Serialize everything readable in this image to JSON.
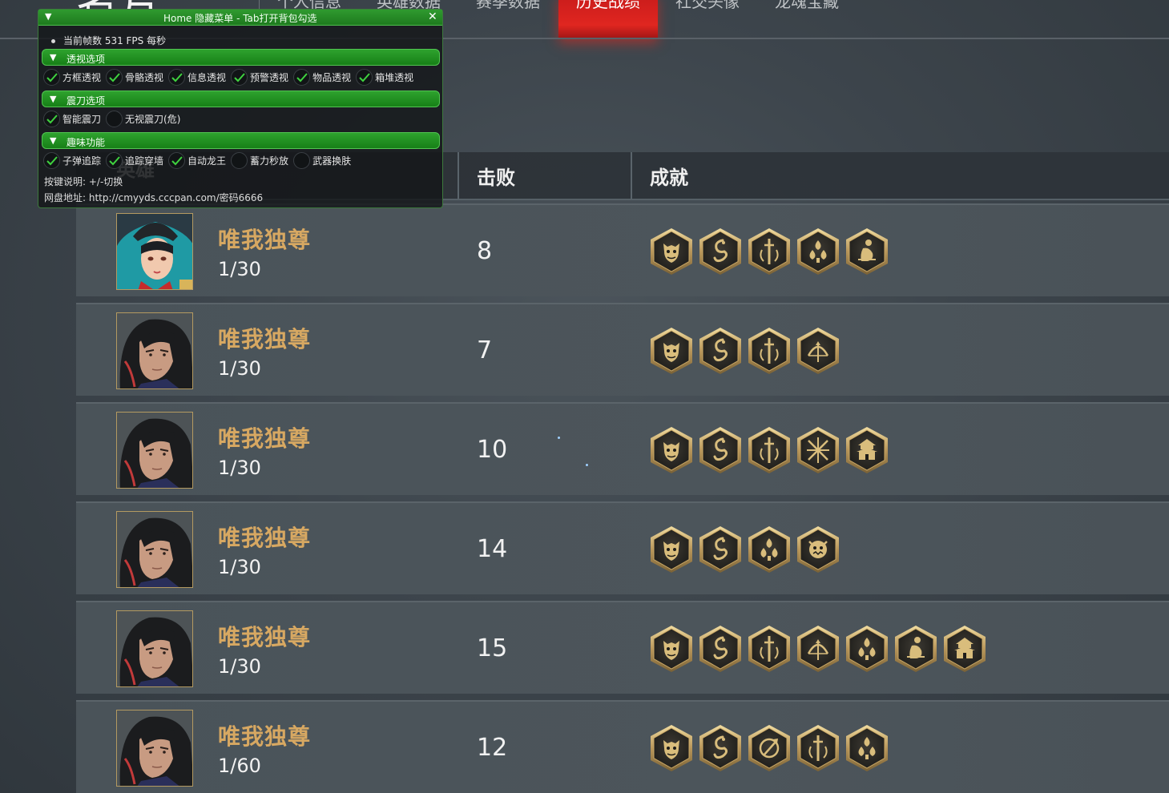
{
  "page_heading": "名片",
  "nav": {
    "tabs": [
      {
        "label": "个人信息",
        "active": false
      },
      {
        "label": "英雄数据",
        "active": false
      },
      {
        "label": "赛季数据",
        "active": false
      },
      {
        "label": "历史战绩",
        "active": true
      },
      {
        "label": "社交头像",
        "active": false
      },
      {
        "label": "龙魂宝藏",
        "active": false
      }
    ],
    "active_color": "#e02620"
  },
  "table": {
    "headers": {
      "hero": "英雄",
      "kills": "击败",
      "achievements": "成就"
    },
    "rows": [
      {
        "hero_name": "唯我独尊",
        "rank": "1/30",
        "kills": "8",
        "avatar": "female-hero-portrait",
        "badges": [
          "demon-mask-icon",
          "dragon-icon",
          "crossed-swords-icon",
          "spade-flowers-icon",
          "crouching-figure-icon"
        ]
      },
      {
        "hero_name": "唯我独尊",
        "rank": "1/30",
        "kills": "7",
        "avatar": "male-hero-portrait",
        "badges": [
          "demon-mask-icon",
          "dragon-icon",
          "crossed-swords-icon",
          "bow-icon"
        ]
      },
      {
        "hero_name": "唯我独尊",
        "rank": "1/30",
        "kills": "10",
        "avatar": "male-hero-portrait",
        "badges": [
          "demon-mask-icon",
          "dragon-icon",
          "crossed-swords-icon",
          "crossed-spears-icon",
          "pagoda-icon"
        ]
      },
      {
        "hero_name": "唯我独尊",
        "rank": "1/30",
        "kills": "14",
        "avatar": "male-hero-portrait",
        "badges": [
          "demon-mask-icon",
          "dragon-icon",
          "spade-flowers-icon",
          "beast-head-icon"
        ]
      },
      {
        "hero_name": "唯我独尊",
        "rank": "1/30",
        "kills": "15",
        "avatar": "male-hero-portrait",
        "badges": [
          "demon-mask-icon",
          "dragon-icon",
          "crossed-swords-icon",
          "bow-icon",
          "spade-flowers-icon",
          "crouching-figure-icon",
          "pagoda-icon"
        ]
      },
      {
        "hero_name": "唯我独尊",
        "rank": "1/60",
        "kills": "12",
        "avatar": "male-hero-portrait",
        "badges": [
          "demon-mask-icon",
          "dragon-icon",
          "spiral-arrow-icon",
          "crossed-swords-icon",
          "spade-flowers-icon"
        ]
      }
    ],
    "name_color": "#d7a862",
    "badge_gold": "#c9ad6f"
  },
  "overlay": {
    "title": "Home 隐藏菜单 - Tab打开背包勾选",
    "close": "✕",
    "fps": "当前帧数 531 FPS 每秒",
    "sections": [
      {
        "label": "透视选项",
        "options": [
          {
            "label": "方框透视",
            "checked": true
          },
          {
            "label": "骨骼透视",
            "checked": true
          },
          {
            "label": "信息透视",
            "checked": true
          },
          {
            "label": "预警透视",
            "checked": true
          },
          {
            "label": "物品透视",
            "checked": true
          },
          {
            "label": "箱堆透视",
            "checked": true
          }
        ]
      },
      {
        "label": "震刀选项",
        "options": [
          {
            "label": "智能震刀",
            "checked": true
          },
          {
            "label": "无视震刀(危)",
            "checked": false
          }
        ]
      },
      {
        "label": "趣味功能",
        "options": [
          {
            "label": "子弹追踪",
            "checked": true
          },
          {
            "label": "追踪穿墙",
            "checked": true
          },
          {
            "label": "自动龙王",
            "checked": true
          },
          {
            "label": "蓄力秒放",
            "checked": false
          },
          {
            "label": "武器换肤",
            "checked": false
          }
        ]
      }
    ],
    "hint": "按键说明: +/-切换",
    "netdisk": "网盘地址: http://cmyyds.cccpan.com/密码6666",
    "accent": "#2ea22e"
  }
}
